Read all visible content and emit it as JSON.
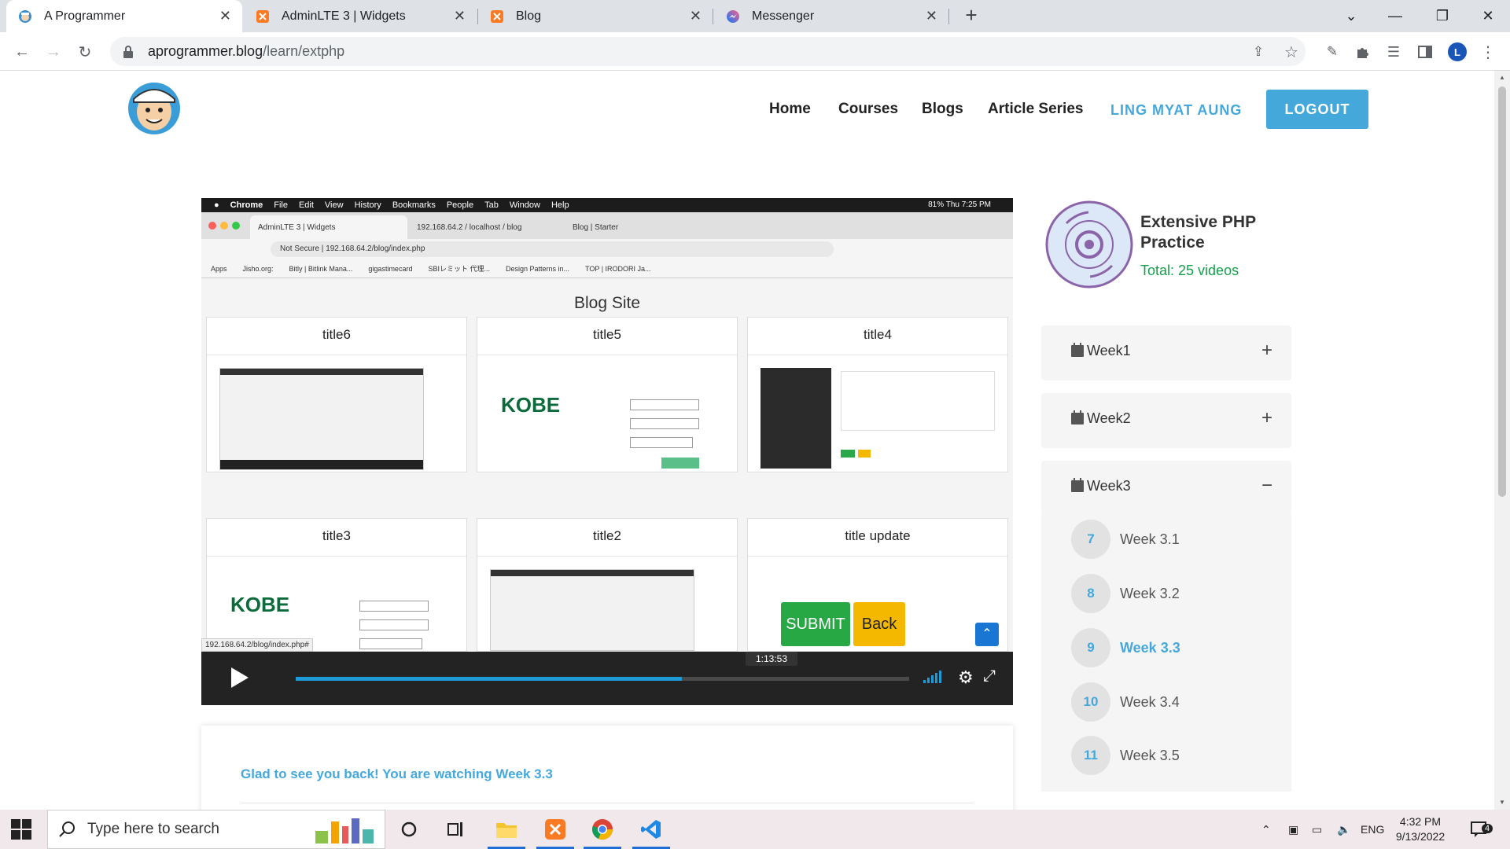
{
  "browser": {
    "tabs": [
      {
        "title": "A Programmer",
        "active": true
      },
      {
        "title": "AdminLTE 3 | Widgets",
        "active": false
      },
      {
        "title": "Blog",
        "active": false
      },
      {
        "title": "Messenger",
        "active": false
      }
    ],
    "url_host": "aprogrammer.blog",
    "url_path": "/learn/extphp",
    "profile_initial": "L"
  },
  "site": {
    "nav": [
      "Home",
      "Courses",
      "Blogs",
      "Article Series"
    ],
    "user_name": "LING MYAT AUNG",
    "logout_label": "LOGOUT"
  },
  "video": {
    "mac_menu": [
      "Chrome",
      "File",
      "Edit",
      "View",
      "History",
      "Bookmarks",
      "People",
      "Tab",
      "Window",
      "Help"
    ],
    "mac_status": "81%   Thu 7:25 PM",
    "inner_tabs": [
      "AdminLTE 3 | Widgets",
      "192.168.64.2 / localhost / blog",
      "Blog | Starter"
    ],
    "inner_url_prefix": "Not Secure",
    "inner_url": "192.168.64.2/blog/index.php",
    "bookmarks": [
      "Apps",
      "Jisho.org:",
      "Bitly | Bitlink Mana...",
      "gigastimecard",
      "SBIレミット 代理...",
      "Design Patterns in...",
      "TOP | IRODORI Ja..."
    ],
    "blog_title": "Blog Site",
    "cards": [
      "title6",
      "title5",
      "title4",
      "title3",
      "title2",
      "title update"
    ],
    "kobe_label": "KOBE",
    "submit_label": "SUBMIT",
    "back_label": "Back",
    "status_url": "192.168.64.2/blog/index.php#",
    "tooltip_time": "1:13:53",
    "progress": 0.63
  },
  "welcome": {
    "message": "Glad to see you back! You are watching Week 3.3"
  },
  "course": {
    "title": "Extensive PHP Practice",
    "total": "Total: 25 videos",
    "weeks": [
      {
        "label": "Week1",
        "toggle": "+"
      },
      {
        "label": "Week2",
        "toggle": "+"
      },
      {
        "label": "Week3",
        "toggle": "−"
      }
    ],
    "lessons": [
      {
        "num": "7",
        "label": "Week 3.1",
        "current": false
      },
      {
        "num": "8",
        "label": "Week 3.2",
        "current": false
      },
      {
        "num": "9",
        "label": "Week 3.3",
        "current": true
      },
      {
        "num": "10",
        "label": "Week 3.4",
        "current": false
      },
      {
        "num": "11",
        "label": "Week 3.5",
        "current": false
      }
    ]
  },
  "taskbar": {
    "search_placeholder": "Type here to search",
    "lang": "ENG",
    "time": "4:32 PM",
    "date": "9/13/2022",
    "notifications": "4"
  },
  "colors": {
    "accent": "#45a8db",
    "green": "#14a04a",
    "progress": "#1e9bd6"
  }
}
